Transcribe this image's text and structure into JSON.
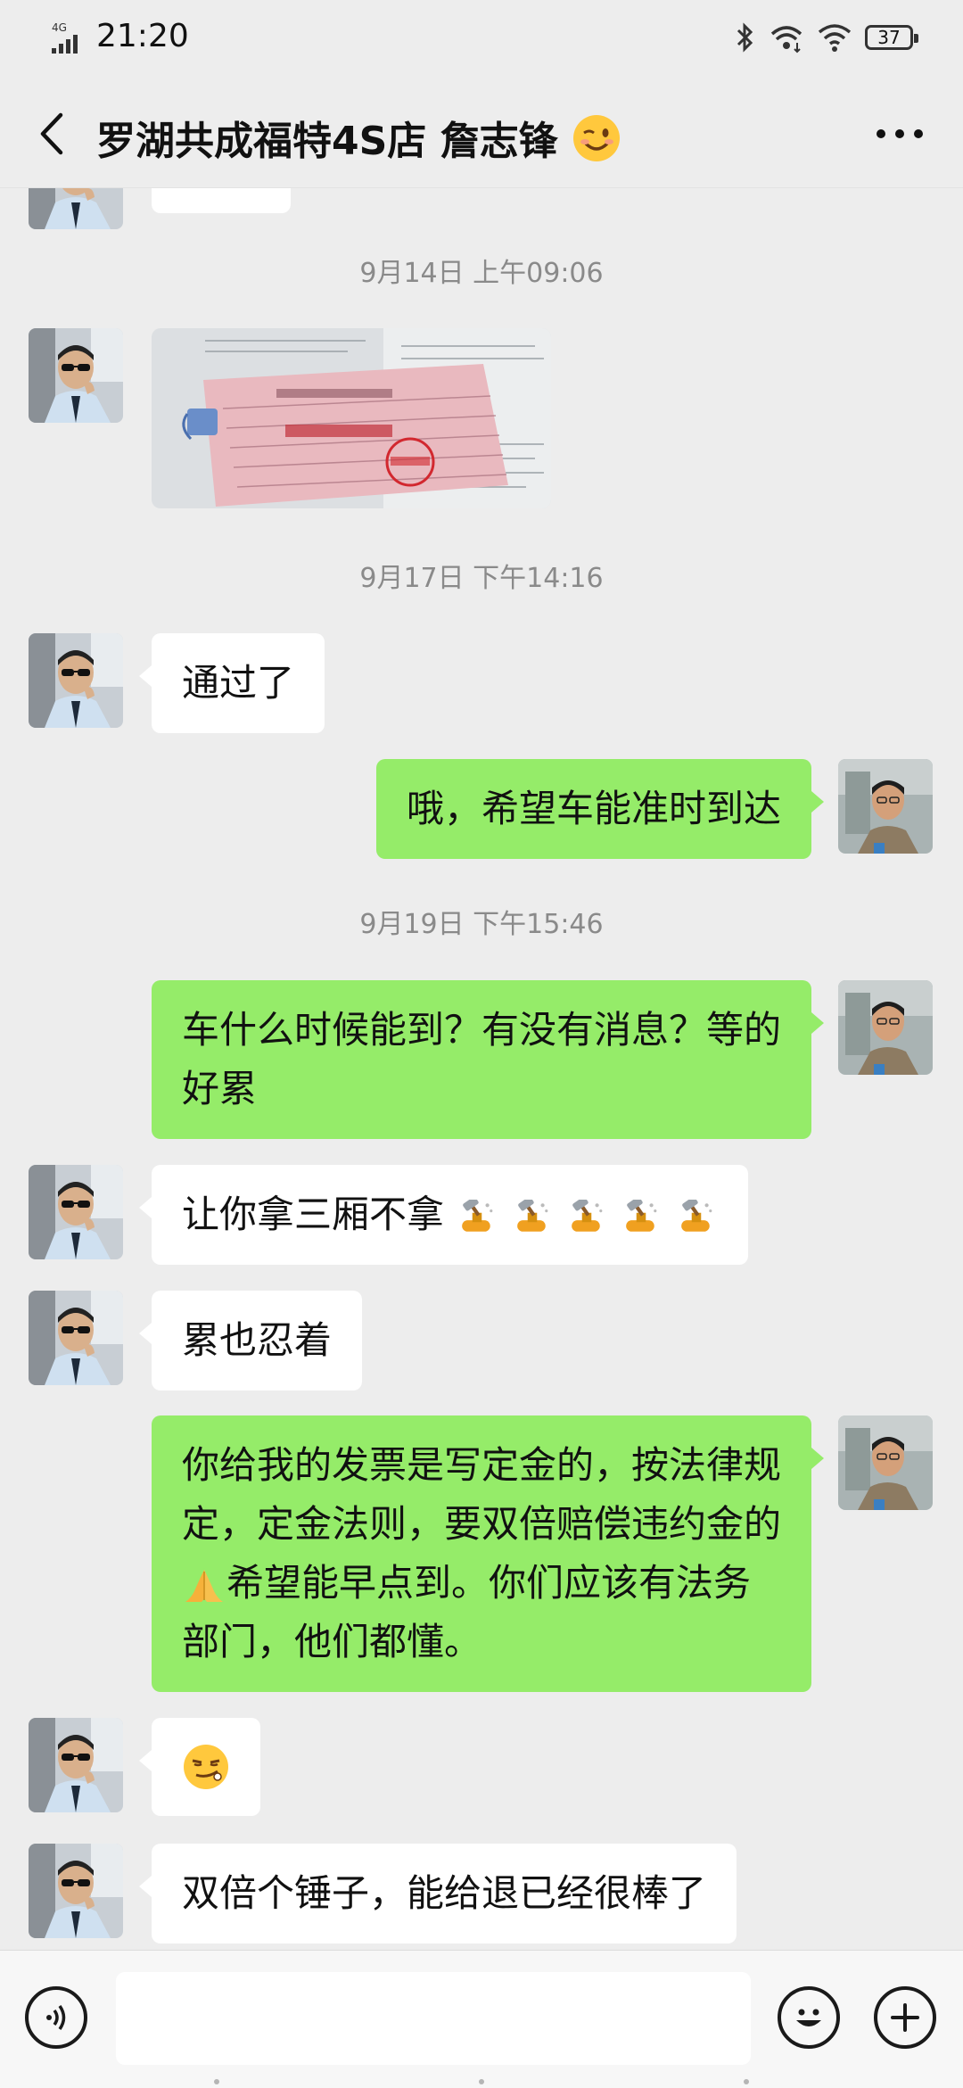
{
  "status_bar": {
    "network": "4G",
    "time": "21:20",
    "battery": "37"
  },
  "header": {
    "title": "罗湖共成福特4S店 詹志锋"
  },
  "chat": {
    "timestamps": [
      "9月14日 上午09:06",
      "9月17日 下午14:16",
      "9月19日 下午15:46"
    ],
    "messages": [
      {
        "sender": "other",
        "text": "通过了"
      },
      {
        "sender": "me",
        "text": "哦，希望车能准时到达"
      },
      {
        "sender": "me",
        "text": "车什么时候能到？有没有消息？等的好累"
      },
      {
        "sender": "other",
        "text": "让你拿三厢不拿"
      },
      {
        "sender": "other",
        "text": "累也忍着"
      },
      {
        "sender": "me",
        "text_a": "你给我的发票是写定金的，按法律规定，定金法则，要双倍赔偿违约金的",
        "text_b": "希望能早点到。你们应该有法务部门，他们都懂。"
      },
      {
        "sender": "other",
        "emoji": "smirk-emoji"
      },
      {
        "sender": "other",
        "text": "双倍个锤子，能给退已经很棒了"
      }
    ]
  },
  "icons": {
    "back": "chevron-left-icon",
    "more": "more-dots-icon",
    "voice": "voice-icon",
    "emoji": "emoji-face-icon",
    "plus": "plus-icon",
    "hammer": "hammer-emoji"
  },
  "colors": {
    "background": "#ededed",
    "outgoing_bubble": "#95ec69",
    "incoming_bubble": "#ffffff",
    "timestamp": "#8a8a8a"
  }
}
